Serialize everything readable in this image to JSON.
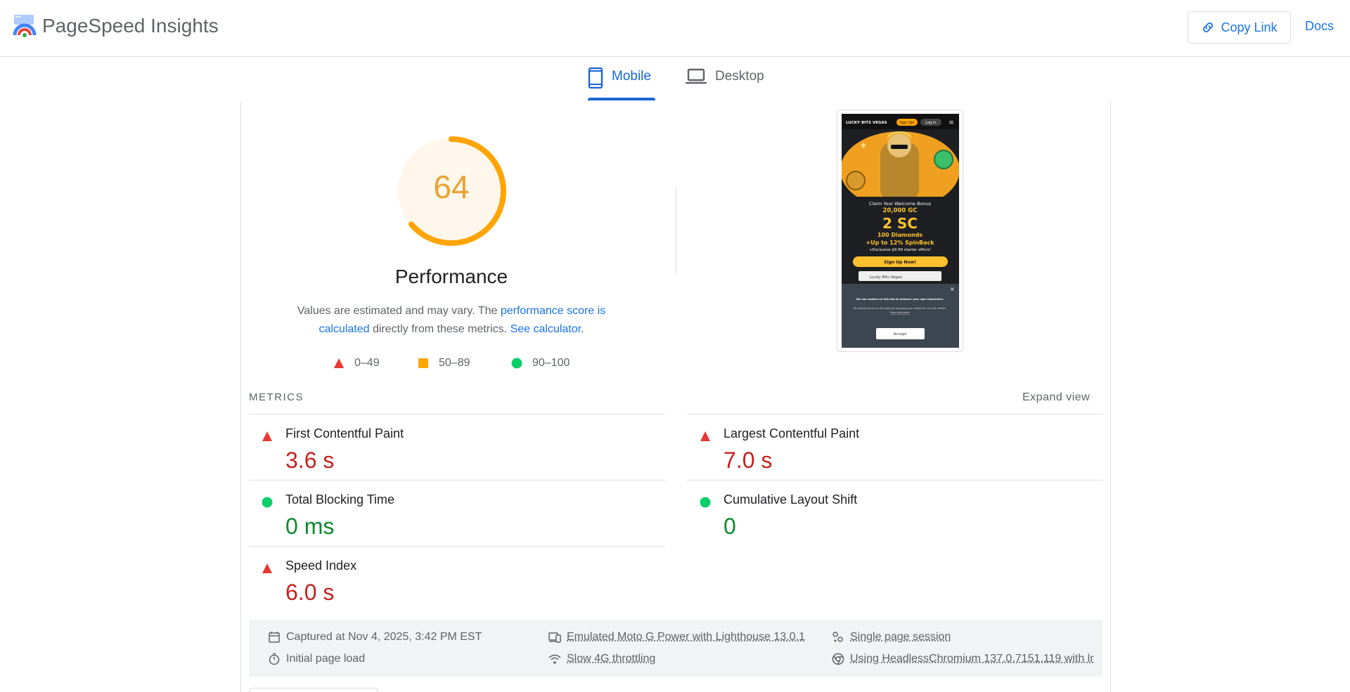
{
  "header": {
    "brand": "PageSpeed Insights",
    "copy_link": "Copy Link",
    "docs": "Docs"
  },
  "tabs": [
    {
      "label": "Mobile",
      "selected": true
    },
    {
      "label": "Desktop",
      "selected": false
    }
  ],
  "performance": {
    "score": "64",
    "score_fraction": 0.64,
    "title": "Performance",
    "desc_1": "Values are estimated and may vary. The ",
    "desc_link_1": "performance score is calculated",
    "desc_2": " directly from these metrics. ",
    "desc_link_2": "See calculator.",
    "legend": [
      "0–49",
      "50–89",
      "90–100"
    ]
  },
  "metrics": {
    "label": "METRICS",
    "expand": "Expand view",
    "items": [
      {
        "name": "First Contentful Paint",
        "value": "3.6 s",
        "rating": "bad"
      },
      {
        "name": "Largest Contentful Paint",
        "value": "7.0 s",
        "rating": "bad"
      },
      {
        "name": "Total Blocking Time",
        "value": "0 ms",
        "rating": "good"
      },
      {
        "name": "Cumulative Layout Shift",
        "value": "0",
        "rating": "good"
      },
      {
        "name": "Speed Index",
        "value": "6.0 s",
        "rating": "bad"
      }
    ]
  },
  "info": {
    "captured": "Captured at Nov 4, 2025, 3:42 PM EST",
    "initial_load": "Initial page load",
    "emulated": "Emulated Moto G Power with Lighthouse 13.0.1",
    "throttling": "Slow 4G throttling",
    "session": "Single page session",
    "browser": "Using HeadlessChromium 137.0.7151.119 with lr"
  },
  "screenshot": {
    "brand": "LUCKY BITS VEGAS",
    "signup": "Sign Up!",
    "login": "Log In",
    "claim": "Claim Your Welcome Bonus",
    "gc": "20,000 GC",
    "sc": "2 SC",
    "diamonds": "100 Diamonds",
    "spinback": "+Up to 12% SpinBack",
    "starter": "+Exclusive $9.99 starter offers!",
    "cta": "Sign Up Now!",
    "second": "Lucky Bits Vegas",
    "cookie_1": "We use cookies on this site to enhance your user experience.",
    "cookie_2": "By clicking any link on this page you are giving your consent for us to set cookies.",
    "cookie_more": "More information",
    "accept": "Accept"
  },
  "colors": {
    "accent": "#1a73e8",
    "score_mid": "#ffa400",
    "bad": "#c5221f",
    "good": "#0d8a2f",
    "fail_indicator": "#e53935",
    "pass_indicator": "#0cce6b"
  }
}
